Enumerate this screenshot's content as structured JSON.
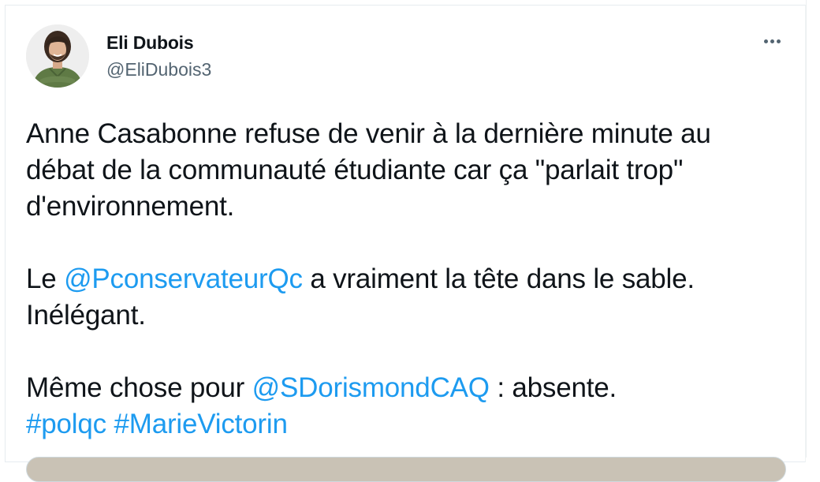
{
  "tweet": {
    "author": {
      "display_name": "Eli Dubois",
      "handle": "@EliDubois3"
    },
    "more_icon": "more-horizontal-icon",
    "paragraph1": "Anne Casabonne refuse de venir à la dernière minute au débat de la communauté étudiante car ça \"parlait trop\" d'environnement.",
    "paragraph2": {
      "before": "Le ",
      "mention": "@PconservateurQc",
      "after": " a vraiment la tête dans le sable. Inélégant."
    },
    "paragraph3": {
      "before": "Même chose pour ",
      "mention": "@SDorismondCAQ",
      "after": " : absente.",
      "hashtag1": "#polqc",
      "space": " ",
      "hashtag2": "#MarieVictorin"
    },
    "colors": {
      "link": "#1d9bf0",
      "text": "#0f1419",
      "secondary": "#536471"
    }
  }
}
